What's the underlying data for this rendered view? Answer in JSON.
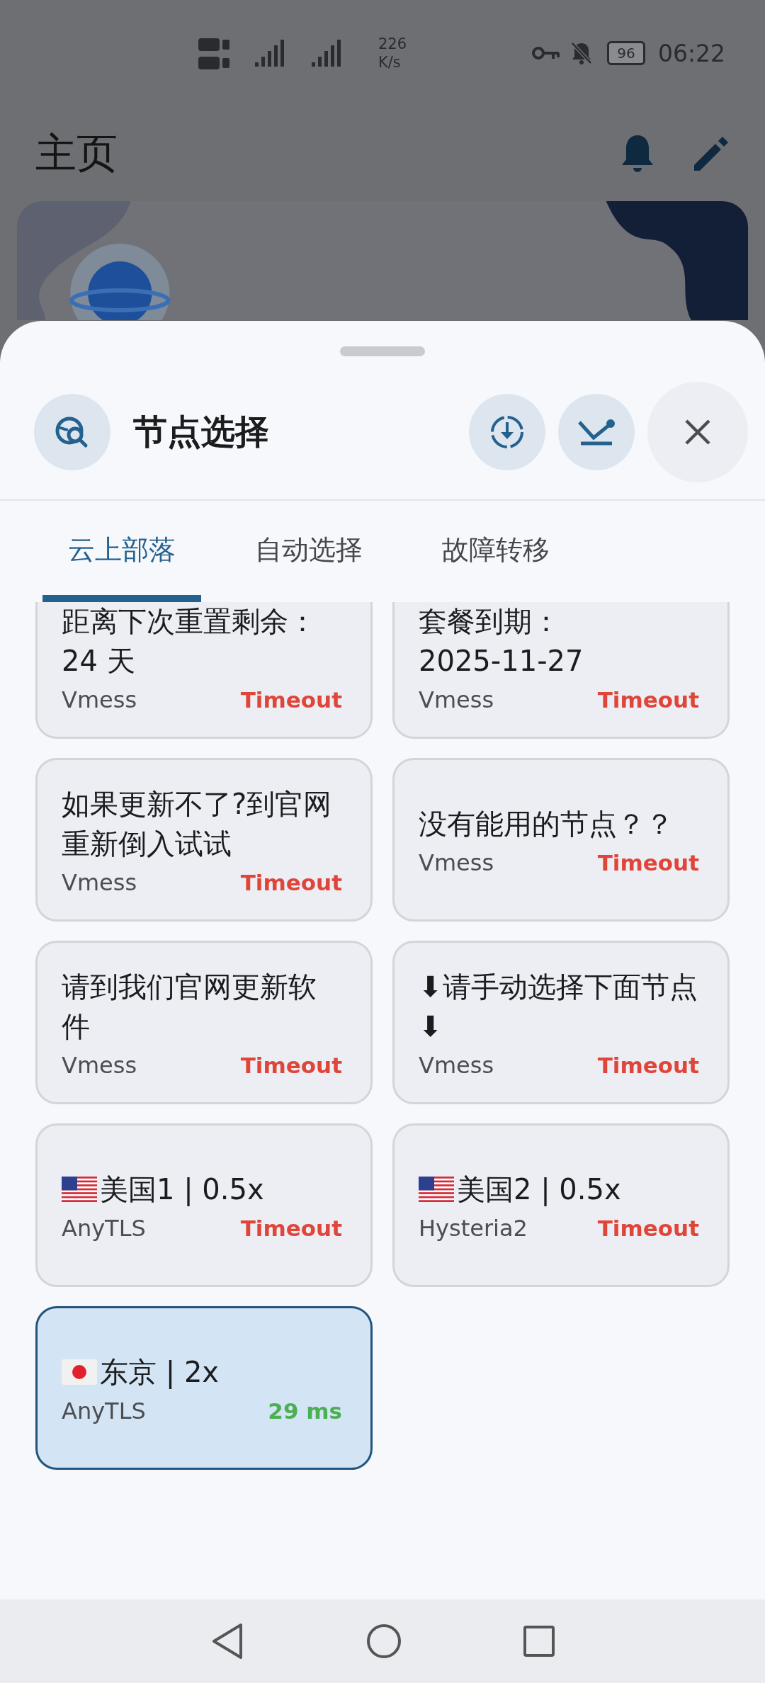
{
  "status_bar": {
    "network_speed": "226",
    "speed_unit": "K/s",
    "battery": "96",
    "time": "06:22"
  },
  "app_bar": {
    "title": "主页"
  },
  "sheet": {
    "title": "节点选择"
  },
  "tabs": [
    {
      "label": "云上部落",
      "selected": true
    },
    {
      "label": "自动选择",
      "selected": false
    },
    {
      "label": "故障转移",
      "selected": false
    }
  ],
  "nodes": [
    {
      "name": "距离下次重置剩余：\n24 天",
      "protocol": "Vmess",
      "delay": "Timeout",
      "color": "#e0453a",
      "selected": false
    },
    {
      "name": "套餐到期：\n2025-11-27",
      "protocol": "Vmess",
      "delay": "Timeout",
      "color": "#e0453a",
      "selected": false
    },
    {
      "name": "如果更新不了?到官网重新倒入试试",
      "protocol": "Vmess",
      "delay": "Timeout",
      "color": "#e0453a",
      "selected": false
    },
    {
      "name": "没有能用的节点？？",
      "protocol": "Vmess",
      "delay": "Timeout",
      "color": "#e0453a",
      "selected": false
    },
    {
      "name": "请到我们官网更新软件",
      "protocol": "Vmess",
      "delay": "Timeout",
      "color": "#e0453a",
      "selected": false
    },
    {
      "name": "⬇请手动选择下面节点⬇",
      "protocol": "Vmess",
      "delay": "Timeout",
      "color": "#e0453a",
      "selected": false
    },
    {
      "kind": "usflag",
      "name": "美国1 | 0.5x",
      "protocol": "AnyTLS",
      "delay": "Timeout",
      "color": "#e0453a",
      "selected": false
    },
    {
      "kind": "usflag",
      "name": "美国2 | 0.5x",
      "protocol": "Hysteria2",
      "delay": "Timeout",
      "color": "#e0453a",
      "selected": false
    },
    {
      "kind": "jpflag",
      "name": "东京 | 2x",
      "protocol": "AnyTLS",
      "delay": "29 ms",
      "color": "#4caf50",
      "selected": true
    }
  ]
}
